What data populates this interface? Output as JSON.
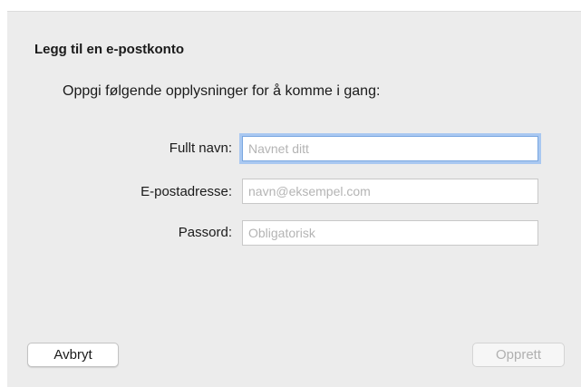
{
  "dialog": {
    "title": "Legg til en e-postkonto",
    "subtitle": "Oppgi følgende opplysninger for å komme i gang:",
    "fields": {
      "full_name": {
        "label": "Fullt navn:",
        "value": "",
        "placeholder": "Navnet ditt",
        "focused": true
      },
      "email": {
        "label": "E-postadresse:",
        "value": "",
        "placeholder": "navn@eksempel.com"
      },
      "password": {
        "label": "Passord:",
        "value": "",
        "placeholder": "Obligatorisk"
      }
    },
    "buttons": {
      "cancel_label": "Avbryt",
      "create_label": "Opprett",
      "create_enabled": false
    }
  },
  "colors": {
    "dialog_background": "#ececec",
    "focus_ring": "#a9c8f1",
    "placeholder_text": "#b4b4b4",
    "disabled_text": "#b0b0b0"
  }
}
